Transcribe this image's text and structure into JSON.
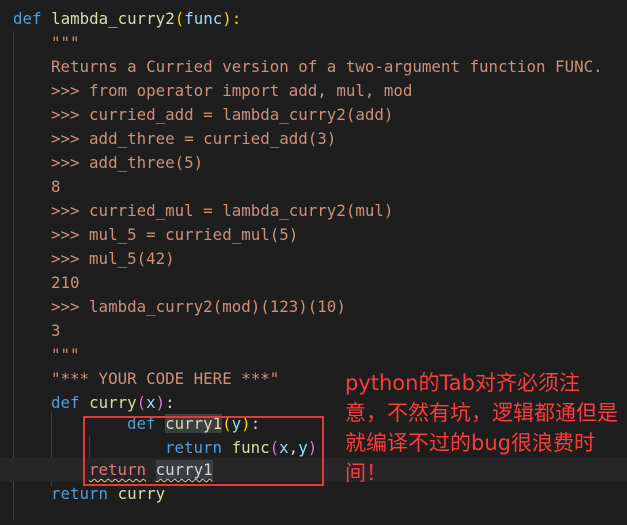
{
  "code": {
    "def_kw": "def",
    "func_name": "lambda_curry2",
    "open_paren": "(",
    "param": "func",
    "close_paren_colon": "):",
    "doc_open": "\"\"\"",
    "doc_line1": "Returns a Curried version of a two-argument function FUNC.",
    "doc_line2": ">>> from operator import add, mul, mod",
    "doc_line3": ">>> curried_add = lambda_curry2(add)",
    "doc_line4": ">>> add_three = curried_add(3)",
    "doc_line5": ">>> add_three(5)",
    "doc_line6": "8",
    "doc_line7": ">>> curried_mul = lambda_curry2(mul)",
    "doc_line8": ">>> mul_5 = curried_mul(5)",
    "doc_line9": ">>> mul_5(42)",
    "doc_line10": "210",
    "doc_line11": ">>> lambda_curry2(mod)(123)(10)",
    "doc_line12": "3",
    "doc_close": "\"\"\"",
    "placeholder_str": "\"*** YOUR CODE HERE ***\"",
    "def_curry_kw": "def",
    "curry_name": "curry",
    "curry_param": "x",
    "curry_colon": ":",
    "def_curry1_kw": "def",
    "curry1_name": "curry1",
    "curry1_param": "y",
    "curry1_colon": ":",
    "return_kw": "return",
    "return_expr_func": "func",
    "return_expr_args_x": "x",
    "return_expr_comma": ",",
    "return_expr_args_y": "y",
    "return2_kw": "return",
    "return2_val": "curry1",
    "return3_kw": "return",
    "return3_val": "curry"
  },
  "annotation": {
    "note_text": "python的Tab对齐必须注意，不然有坑，逻辑都通但是就编译不过的bug很浪费时间！"
  },
  "colors": {
    "background": "#1e1e1e",
    "keyword": "#569cd6",
    "function": "#dcdcaa",
    "parameter": "#9cdcfe",
    "string": "#ce9178",
    "annotation_red": "#e53935"
  }
}
